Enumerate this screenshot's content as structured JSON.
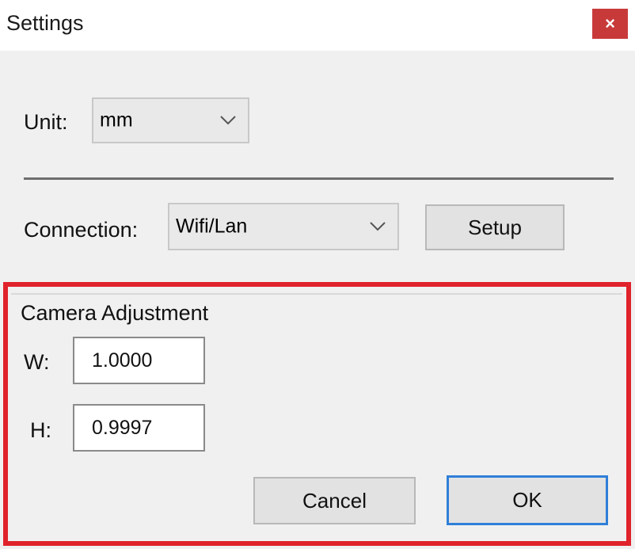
{
  "window": {
    "title": "Settings",
    "close_icon": "close-icon",
    "close_glyph": "×"
  },
  "unit": {
    "label": "Unit:",
    "selected": "mm"
  },
  "connection": {
    "label": "Connection:",
    "selected": "Wifi/Lan",
    "setup_label": "Setup"
  },
  "camera_adjustment": {
    "title": "Camera Adjustment",
    "width_label": "W:",
    "width_value": "1.0000",
    "height_label": "H:",
    "height_value": "0.9997"
  },
  "actions": {
    "cancel_label": "Cancel",
    "ok_label": "OK"
  },
  "colors": {
    "close_button": "#c83a3a",
    "highlight_border": "#e0222b",
    "default_button_border": "#2f7fd8",
    "window_background": "#f0f0f0"
  }
}
